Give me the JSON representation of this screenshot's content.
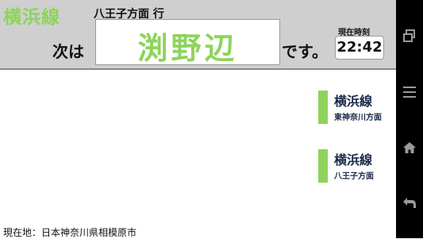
{
  "header": {
    "line_name": "横浜線",
    "direction": "八王子方面 行",
    "next_label": "次は",
    "next_station": "渕野辺",
    "desu": "です。",
    "time_label": "現在時刻",
    "time_value": "22:42"
  },
  "lines": [
    {
      "name": "横浜線",
      "direction": "東神奈川方面"
    },
    {
      "name": "横浜線",
      "direction": "八王子方面"
    }
  ],
  "footer": {
    "location": "現在地：日本神奈川県相模原市"
  },
  "navbar": {
    "icons": [
      "recent-apps-icon",
      "menu-icon",
      "home-icon",
      "back-icon"
    ]
  },
  "colors": {
    "accent": "#8fd35b",
    "header_bg": "#cfcfcf",
    "text_dark": "#1b2a4a"
  }
}
